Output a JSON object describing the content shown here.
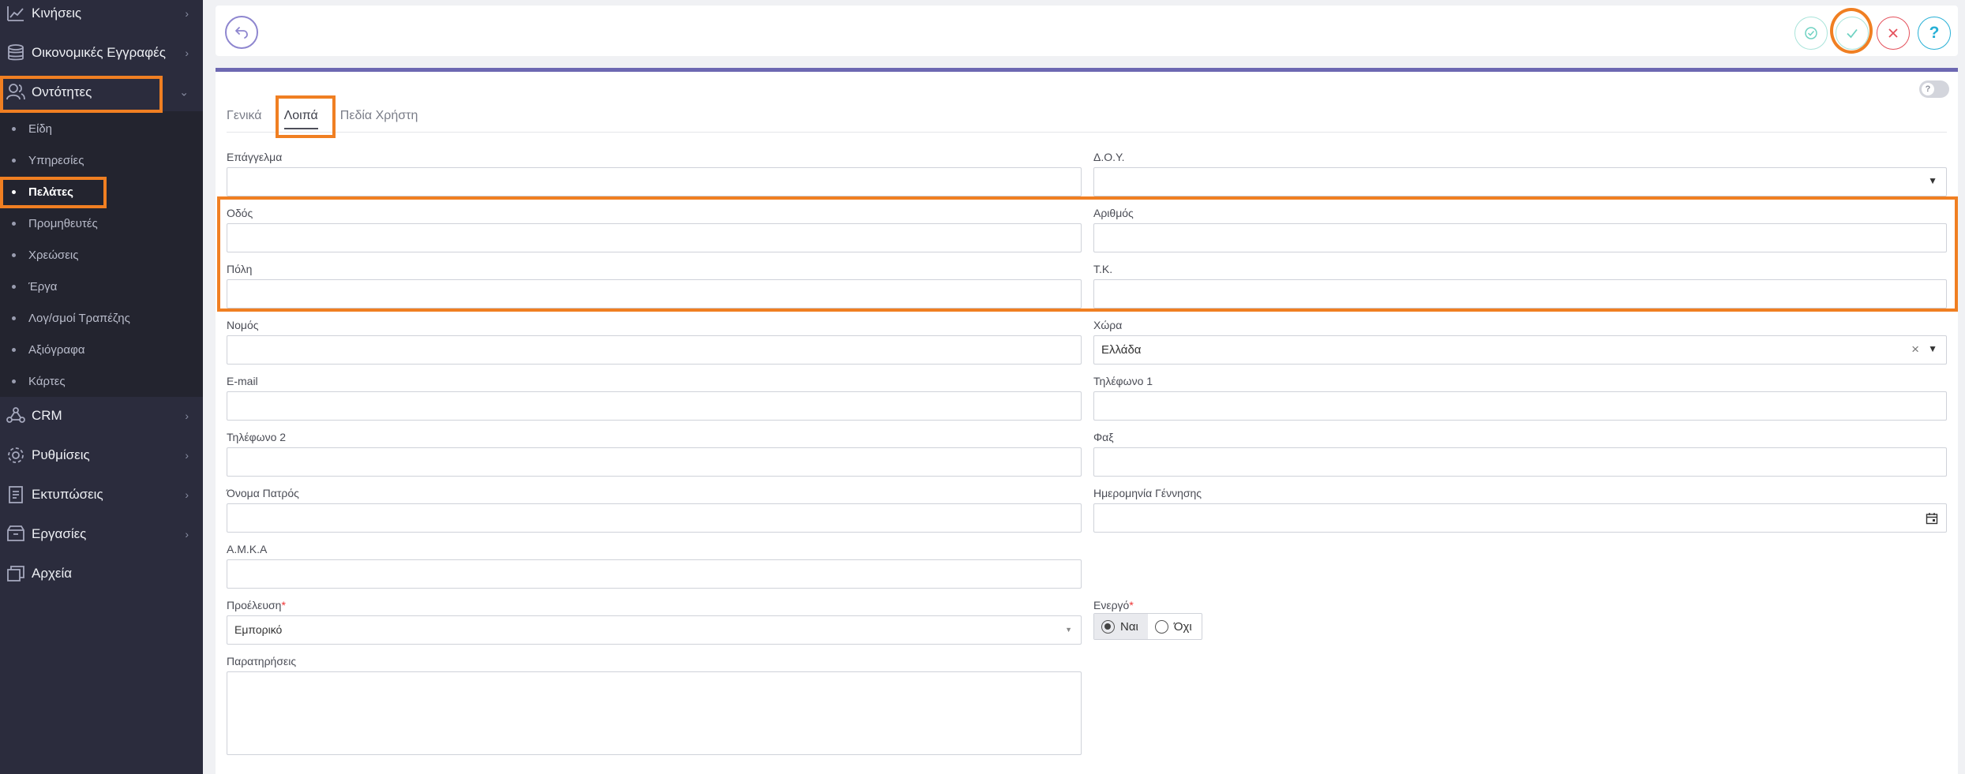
{
  "sidebar": {
    "items": [
      {
        "label": "Κινήσεις",
        "icon": "chart-icon"
      },
      {
        "label": "Οικονομικές Εγγραφές",
        "icon": "coins-icon"
      },
      {
        "label": "Οντότητες",
        "icon": "users-icon"
      },
      {
        "label": "CRM",
        "icon": "crm-icon"
      },
      {
        "label": "Ρυθμίσεις",
        "icon": "gear-icon"
      },
      {
        "label": "Εκτυπώσεις",
        "icon": "document-icon"
      },
      {
        "label": "Εργασίες",
        "icon": "archive-box-icon"
      },
      {
        "label": "Αρχεία",
        "icon": "files-icon"
      }
    ],
    "submenu": [
      {
        "label": "Είδη"
      },
      {
        "label": "Υπηρεσίες"
      },
      {
        "label": "Πελάτες",
        "active": true
      },
      {
        "label": "Προμηθευτές"
      },
      {
        "label": "Χρεώσεις"
      },
      {
        "label": "Έργα"
      },
      {
        "label": "Λογ/σμοί Τραπέζης"
      },
      {
        "label": "Αξιόγραφα"
      },
      {
        "label": "Κάρτες"
      }
    ]
  },
  "toolbar": {
    "buttons": [
      "back-icon",
      "check-circle-icon",
      "check-icon",
      "close-icon",
      "help-icon"
    ],
    "help_label": "?",
    "colors": {
      "back": "#8e86cf",
      "save": "#3ec6b0",
      "cancel": "#e4505b",
      "help": "#27b0d6"
    }
  },
  "card": {
    "toggle_label": "?",
    "tabs": [
      "Γενικά",
      "Λοιπά",
      "Πεδία Χρήστη"
    ],
    "active_tab": "Λοιπά"
  },
  "form": {
    "profession": {
      "label": "Επάγγελμα",
      "value": ""
    },
    "tax_office": {
      "label": "Δ.Ο.Υ.",
      "value": ""
    },
    "street": {
      "label": "Οδός",
      "value": ""
    },
    "number": {
      "label": "Αριθμός",
      "value": ""
    },
    "city": {
      "label": "Πόλη",
      "value": ""
    },
    "postal_code": {
      "label": "Τ.Κ.",
      "value": ""
    },
    "prefecture": {
      "label": "Νομός",
      "value": ""
    },
    "country": {
      "label": "Χώρα",
      "value": "Ελλάδα"
    },
    "email": {
      "label": "E-mail",
      "value": ""
    },
    "phone1": {
      "label": "Τηλέφωνο 1",
      "value": ""
    },
    "phone2": {
      "label": "Τηλέφωνο 2",
      "value": ""
    },
    "fax": {
      "label": "Φαξ",
      "value": ""
    },
    "father_name": {
      "label": "Όνομα Πατρός",
      "value": ""
    },
    "birth_date": {
      "label": "Ημερομηνία Γέννησης",
      "value": ""
    },
    "amka": {
      "label": "Α.Μ.Κ.Α",
      "value": ""
    },
    "origin": {
      "label": "Προέλευση",
      "required_mark": "*",
      "value": "Εμπορικό"
    },
    "active": {
      "label": "Ενεργό",
      "required_mark": "*",
      "options": [
        "Ναι",
        "Όχι"
      ],
      "selected": "Ναι"
    },
    "notes": {
      "label": "Παρατηρήσεις",
      "value": ""
    }
  },
  "accent_colors": {
    "highlight": "#f07f22",
    "card_top": "#6d68b2",
    "sidebar": "#2b2c3d"
  }
}
